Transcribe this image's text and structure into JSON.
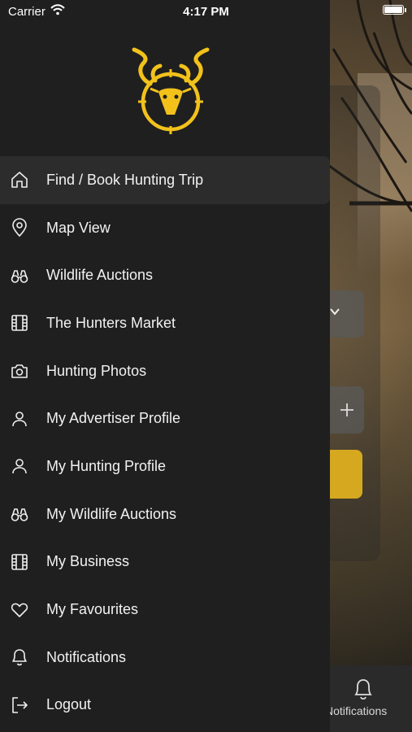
{
  "status_bar": {
    "carrier": "Carrier",
    "time": "4:17 PM"
  },
  "background": {
    "tab_label": "Notifications",
    "accent_color": "#d6a820"
  },
  "logo": {
    "icon": "kudu-crosshair-logo",
    "color": "#f2c21b"
  },
  "menu": {
    "items": [
      {
        "label": "Find / Book Hunting Trip",
        "icon": "home-icon",
        "active": true
      },
      {
        "label": "Map View",
        "icon": "map-pin-icon"
      },
      {
        "label": "Wildlife Auctions",
        "icon": "binoculars-icon"
      },
      {
        "label": "The Hunters Market",
        "icon": "film-grid-icon"
      },
      {
        "label": "Hunting Photos",
        "icon": "camera-icon"
      },
      {
        "label": "My Advertiser Profile",
        "icon": "user-icon"
      },
      {
        "label": "My Hunting Profile",
        "icon": "user-icon"
      },
      {
        "label": "My Wildlife Auctions",
        "icon": "binoculars-icon"
      },
      {
        "label": "My Business",
        "icon": "film-grid-icon"
      },
      {
        "label": "My Favourites",
        "icon": "heart-icon"
      },
      {
        "label": "Notifications",
        "icon": "bell-icon"
      },
      {
        "label": "Logout",
        "icon": "logout-icon"
      }
    ]
  }
}
